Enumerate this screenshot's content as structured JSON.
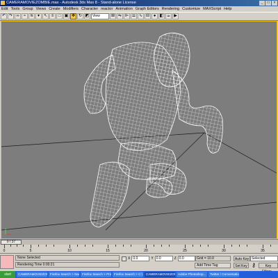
{
  "window": {
    "title": "CAMERAMOVIEZOMBIE.max - Autodesk 3ds Max 8 - Stand-alone License",
    "buttons": [
      "_",
      "□",
      "×"
    ]
  },
  "menu": [
    "Edit",
    "Tools",
    "Group",
    "Views",
    "Create",
    "Modifiers",
    "Character",
    "reactor",
    "Animation",
    "Graph Editors",
    "Rendering",
    "Customize",
    "MAXScript",
    "Help"
  ],
  "toolbar": {
    "reference_coord": "View",
    "icons": [
      "undo-icon",
      "redo-icon",
      "link-icon",
      "unlink-icon",
      "bind-icon",
      "filter-icon",
      "select-icon",
      "select-name-icon",
      "region-icon",
      "window-icon",
      "move-icon",
      "rotate-icon",
      "scale-icon"
    ]
  },
  "viewport": {
    "label": "",
    "background": "#7d7d7d",
    "border_color": "#f0c000"
  },
  "time_slider": {
    "position_label": "0 / 37",
    "ticks": [
      "0",
      "5",
      "10",
      "15",
      "20",
      "25",
      "30",
      "35"
    ]
  },
  "status": {
    "selection": "None Selected",
    "render_time": "Rendering Time  0:00:21",
    "x_label": "X",
    "x_value": "0.0",
    "y_label": "Y",
    "y_value": "0.0",
    "z_label": "Z",
    "z_value": "0.0",
    "grid": "Grid = 10.0",
    "add_time_tag": "Add Time Tag",
    "auto_key": "Auto Key",
    "selected_dropdown": "Selected",
    "set_key": "Set Key",
    "key_filters": "Key Filters..."
  },
  "taskbar": {
    "start": "start",
    "items": [
      "CAMERAMOVIEZOMBIE...",
      "Firefox Search > Nav...",
      "Firefox Search > Produc...",
      "Firefox Search > C:\\...",
      "CAMERAMOVIEZOMBIE...",
      "Adobe Photoshop...",
      "Twitter / Conversation"
    ]
  }
}
